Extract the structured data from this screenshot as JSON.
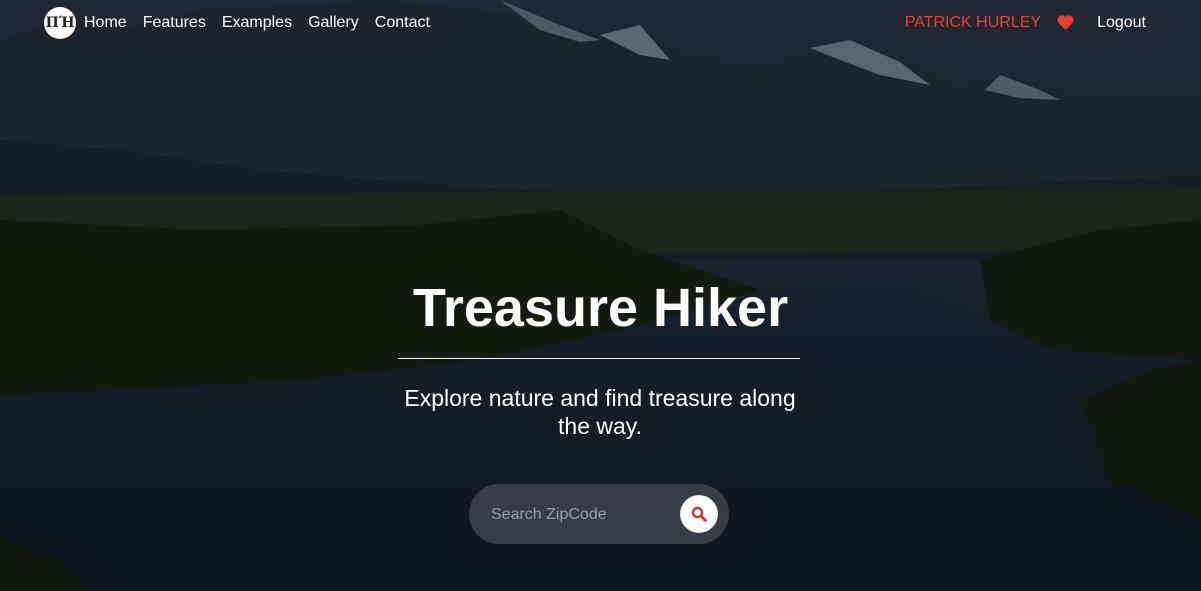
{
  "nav": {
    "logo_text": "ΠΉ",
    "links": [
      "Home",
      "Features",
      "Examples",
      "Gallery",
      "Contact"
    ],
    "user_name": "PATRICK HURLEY",
    "logout_label": "Logout"
  },
  "hero": {
    "title": "Treasure Hiker",
    "subtitle": "Explore nature and find treasure along the way."
  },
  "search": {
    "placeholder": "Search ZipCode",
    "value": ""
  },
  "icons": {
    "logo": "th-logo-icon",
    "favorite": "heart-icon",
    "search": "search-icon"
  },
  "colors": {
    "accent": "#e8412c",
    "text": "#ffffff"
  }
}
